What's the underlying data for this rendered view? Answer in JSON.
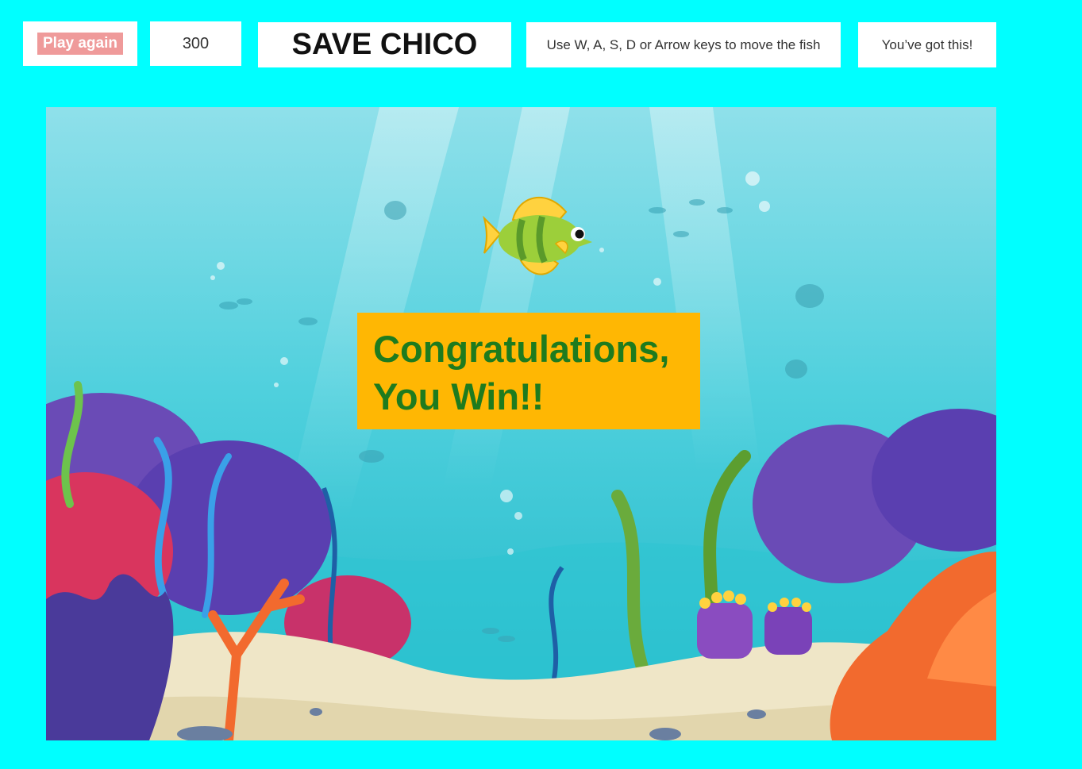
{
  "header": {
    "play_again_label": "Play again",
    "score": "300",
    "title": "SAVE CHICO",
    "instructions": "Use W, A, S, D or Arrow keys to move the fish",
    "encouragement": "You’ve got this!"
  },
  "game": {
    "win_line1": "Congratulations,",
    "win_line2": "You Win!!",
    "player": "fish-icon"
  },
  "colors": {
    "page_background": "#00ffff",
    "button": "#ef9a9a",
    "win_box": "#ffb703",
    "win_text": "#1e7b1e"
  }
}
